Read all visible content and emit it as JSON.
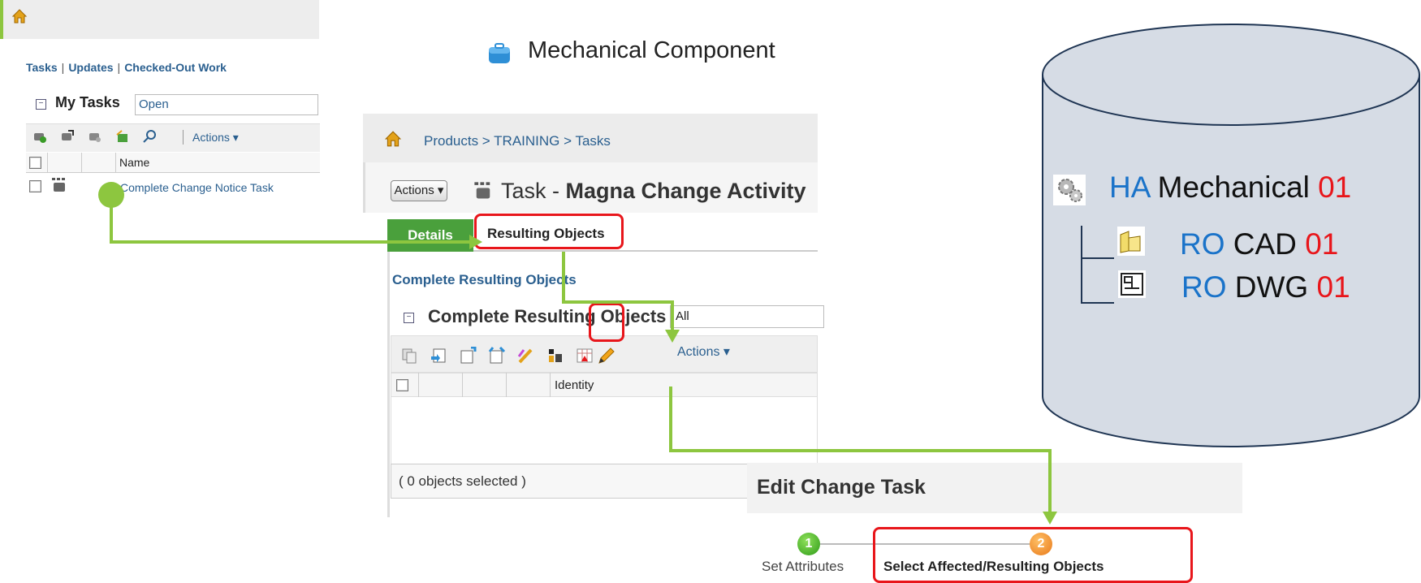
{
  "panel_tasks": {
    "tabs": [
      "Tasks",
      "Updates",
      "Checked-Out Work"
    ],
    "section_title": "My Tasks",
    "filter_value": "Open",
    "toolbar_actions_label": "Actions",
    "column_header": "Name",
    "row_name": "Complete Change Notice Task"
  },
  "mechanical_component_label": "Mechanical Component",
  "panel_task": {
    "breadcrumb": "Products > TRAINING > Tasks",
    "actions_button": "Actions",
    "title_prefix": "Task - ",
    "title_name": "Magna Change Activity",
    "tab_details": "Details",
    "tab_resulting_objects": "Resulting Objects",
    "complete_link": "Complete Resulting Objects",
    "section_title": "Complete Resulting Objects",
    "filter_value": "All",
    "toolbar_actions_label": "Actions",
    "column_identity": "Identity",
    "footer_status": "( 0 objects selected )"
  },
  "panel_edit": {
    "title": "Edit Change Task",
    "step1_number": "1",
    "step1_label": "Set Attributes",
    "step2_number": "2",
    "step2_label": "Select Affected/Resulting Objects"
  },
  "database": {
    "root": {
      "prefix": "HA",
      "name": "Mechanical",
      "rev": "01"
    },
    "children": [
      {
        "prefix": "RO",
        "name": "CAD",
        "rev": "01"
      },
      {
        "prefix": "RO",
        "name": "DWG",
        "rev": "01"
      }
    ]
  },
  "colors": {
    "connector_green": "#8dc63f",
    "highlight_red": "#e8161b",
    "link_blue": "#2a5f8f",
    "prefix_blue": "#1a73c9"
  }
}
